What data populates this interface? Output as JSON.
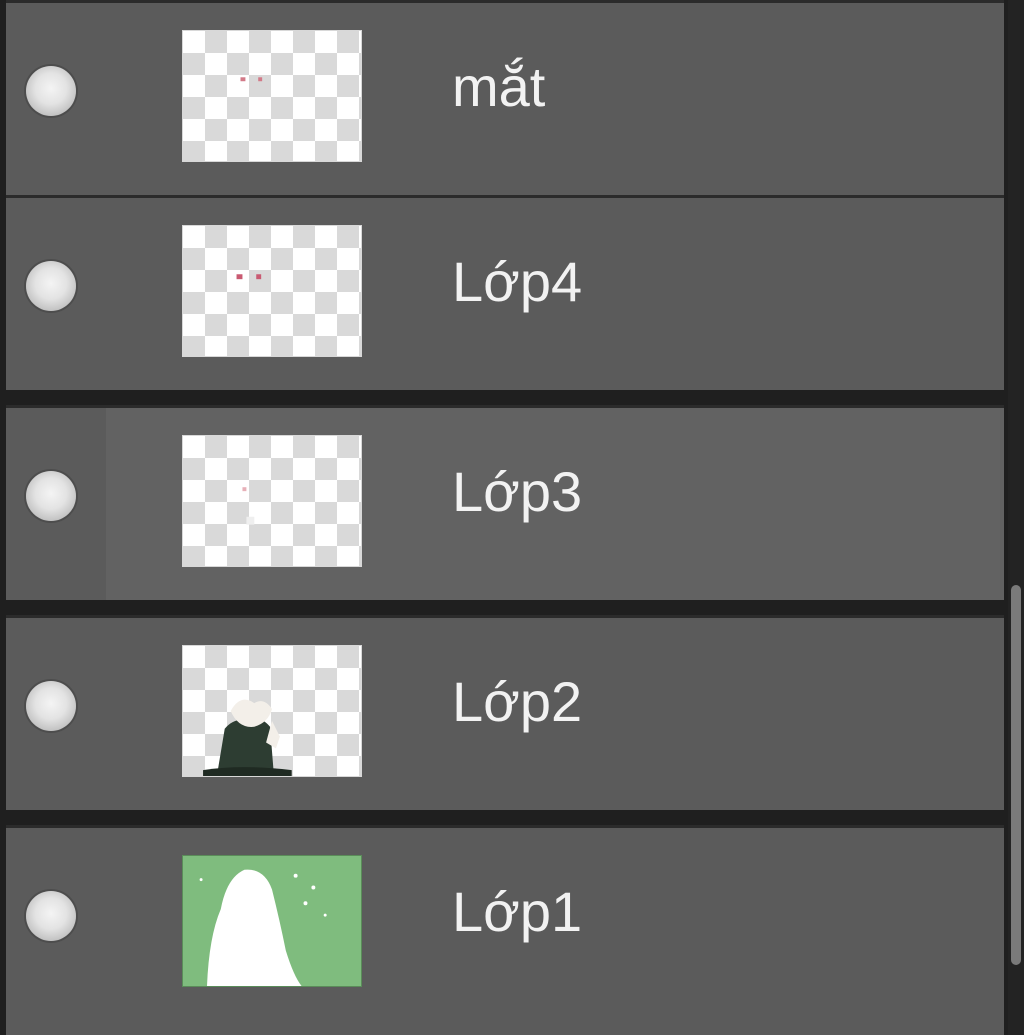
{
  "layers_panel": {
    "layers": [
      {
        "name": "mắt",
        "visible": true,
        "thumbnail": "transparent-layer-small-marks"
      },
      {
        "name": "Lớp4",
        "visible": true,
        "thumbnail": "transparent-layer-red-marks"
      },
      {
        "name": "Lớp3",
        "visible": true,
        "thumbnail": "transparent-layer-faint-marks"
      },
      {
        "name": "Lớp2",
        "visible": true,
        "thumbnail": "character-figure"
      },
      {
        "name": "Lớp1",
        "visible": true,
        "thumbnail": "green-background-white-silhouette"
      }
    ]
  },
  "colors": {
    "row_background": "#5b5b5b",
    "row_background_alt": "#626262",
    "row_separator": "#2b2b2b",
    "label_text": "#f2f2f2",
    "visibility_dot": "#e3e3e3",
    "layer1_green": "#7fbc7e"
  }
}
